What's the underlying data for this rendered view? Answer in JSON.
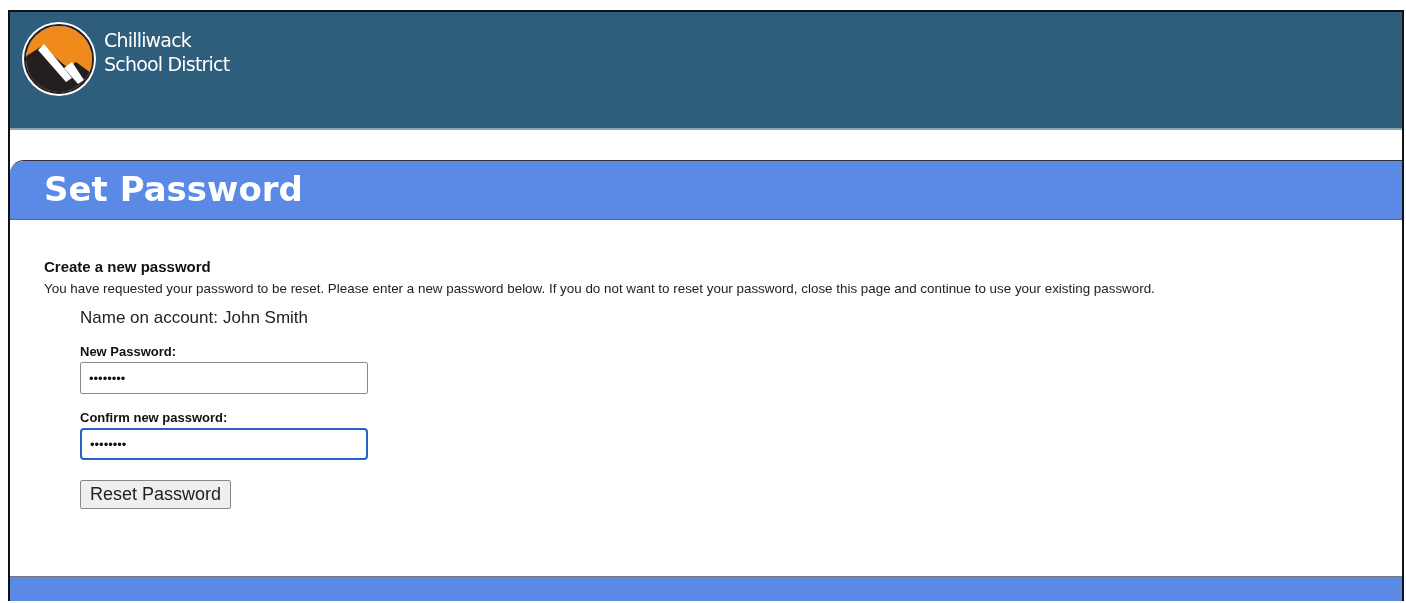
{
  "header": {
    "logo_text": [
      "Chilliwack",
      "School District"
    ]
  },
  "panel": {
    "title": "Set Password"
  },
  "form": {
    "heading": "Create a new password",
    "description": "You have requested your password to be reset. Please enter a new password below. If you do not want to reset your password, close this page and continue to use your existing password.",
    "account_label": "Name on account:",
    "account_name": "John Smith",
    "fields": [
      {
        "label": "New Password:",
        "value": "••••••••",
        "focused": false
      },
      {
        "label": "Confirm new password:",
        "value": "••••••••",
        "focused": true
      }
    ],
    "button": "Reset Password"
  }
}
